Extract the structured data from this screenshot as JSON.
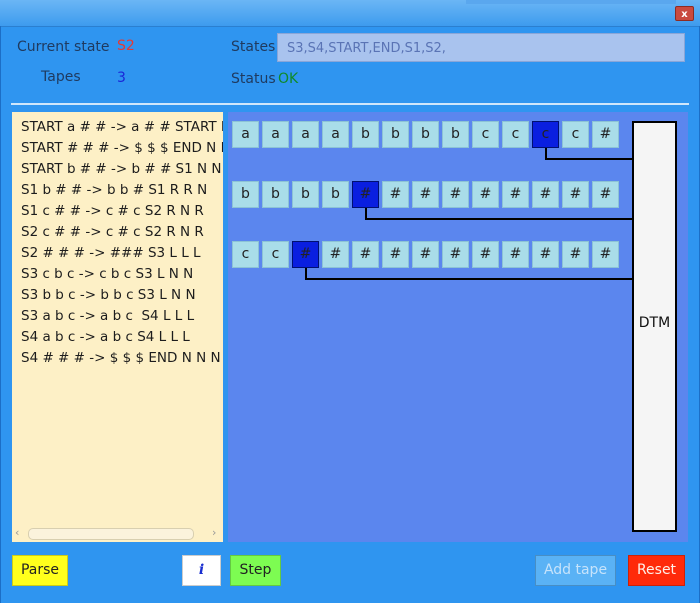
{
  "window": {
    "close_label": "x"
  },
  "header": {
    "current_state_label": "Current state",
    "current_state_value": "S2",
    "tapes_label": "Tapes",
    "tapes_value": "3",
    "states_label": "States",
    "states_value": "S3,S4,START,END,S1,S2,",
    "status_label": "Status",
    "status_value": "OK"
  },
  "rules": [
    "START a # # -> a # # START R N N",
    "START # # # -> $ $ $ END N N N",
    "START b # # -> b # # S1 N N N",
    "S1 b # # -> b b # S1 R R N",
    "S1 c # # -> c # c S2 R N R",
    "S2 c # # -> c # c S2 R N R",
    "S2 # # # -> ### S3 L L L",
    "S3 c b c -> c b c S3 L N N",
    "S3 b b c -> b b c S3 L N N",
    "S3 a b c -> a b c  S4 L L L",
    "S4 a b c -> a b c S4 L L L",
    "S4 # # # -> $ $ $ END N N N"
  ],
  "tapes": [
    {
      "cells": [
        "a",
        "a",
        "a",
        "a",
        "b",
        "b",
        "b",
        "b",
        "c",
        "c",
        "c",
        "c",
        "#"
      ],
      "head": 10
    },
    {
      "cells": [
        "b",
        "b",
        "b",
        "b",
        "#",
        "#",
        "#",
        "#",
        "#",
        "#",
        "#",
        "#",
        "#"
      ],
      "head": 4
    },
    {
      "cells": [
        "c",
        "c",
        "#",
        "#",
        "#",
        "#",
        "#",
        "#",
        "#",
        "#",
        "#",
        "#",
        "#"
      ],
      "head": 2
    }
  ],
  "machine": {
    "label": "DTM"
  },
  "buttons": {
    "parse": "Parse",
    "info": "i",
    "step": "Step",
    "add_tape": "Add tape",
    "reset": "Reset"
  },
  "colors": {
    "background": "#2f95f0",
    "tape_area": "#5b86ee",
    "rules_panel": "#fdf0c6",
    "cell": "#a9dde9",
    "head_cell": "#0a1fe0",
    "state_value": "#e53935",
    "status_ok": "#0f8a2a"
  }
}
